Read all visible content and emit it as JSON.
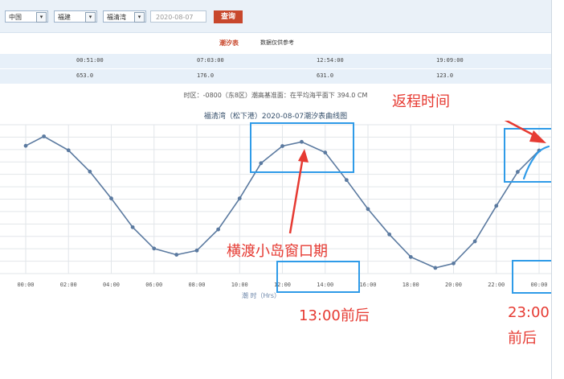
{
  "toolbar": {
    "country": "中国",
    "province": "福建",
    "port": "福清湾",
    "date_placeholder": "2020-08-07",
    "query_label": "查询",
    "dropdown_glyph": "▾"
  },
  "tabs": {
    "active": "潮汐表",
    "reference": "数据仅供参考"
  },
  "tide_table": {
    "times": [
      "00:51:00",
      "07:03:00",
      "12:54:00",
      "19:09:00"
    ],
    "heights": [
      "653.0",
      "176.0",
      "631.0",
      "123.0"
    ]
  },
  "note": "时区：-0800（东8区）潮高基准面：在平均海平面下 394.0 CM",
  "chart_title": "福清湾（松下港）2020-08-07潮汐表曲线图",
  "annotations": {
    "return_time": "返程时间",
    "ferry_window": "横渡小岛窗口期",
    "around_13": "13:00前后",
    "around_23_line1": "23:00",
    "around_23_line2": "前后"
  },
  "colors": {
    "curve": "#5b7aa0",
    "highlight_box": "#2f9be8",
    "annotation_red": "#e63a32",
    "query_button": "#c8472c"
  },
  "chart_data": {
    "type": "line",
    "title": "福清湾（松下港）2020-08-07潮汐表曲线图",
    "xlabel": "潮 时（Hrs）",
    "ylabel": "",
    "x_tick_labels": [
      "00:00",
      "02:00",
      "04:00",
      "06:00",
      "08:00",
      "10:00",
      "12:00",
      "14:00",
      "16:00",
      "18:00",
      "20:00",
      "22:00",
      "00:00"
    ],
    "ylim": [
      100,
      700
    ],
    "grid": true,
    "series": [
      {
        "values": [
          {
            "x": 0,
            "y": 615
          },
          {
            "x": 0.85,
            "y": 653
          },
          {
            "x": 2,
            "y": 597
          },
          {
            "x": 3,
            "y": 511
          },
          {
            "x": 4,
            "y": 403
          },
          {
            "x": 5,
            "y": 287
          },
          {
            "x": 6,
            "y": 201
          },
          {
            "x": 7.05,
            "y": 176
          },
          {
            "x": 8,
            "y": 193
          },
          {
            "x": 9,
            "y": 278
          },
          {
            "x": 10,
            "y": 403
          },
          {
            "x": 11,
            "y": 545
          },
          {
            "x": 12,
            "y": 614
          },
          {
            "x": 12.9,
            "y": 631
          },
          {
            "x": 14,
            "y": 588
          },
          {
            "x": 15,
            "y": 477
          },
          {
            "x": 16,
            "y": 360
          },
          {
            "x": 17,
            "y": 258
          },
          {
            "x": 18,
            "y": 167
          },
          {
            "x": 19.15,
            "y": 123
          },
          {
            "x": 20,
            "y": 141
          },
          {
            "x": 21,
            "y": 230
          },
          {
            "x": 22,
            "y": 373
          },
          {
            "x": 23,
            "y": 510
          },
          {
            "x": 24,
            "y": 596
          }
        ]
      }
    ]
  }
}
